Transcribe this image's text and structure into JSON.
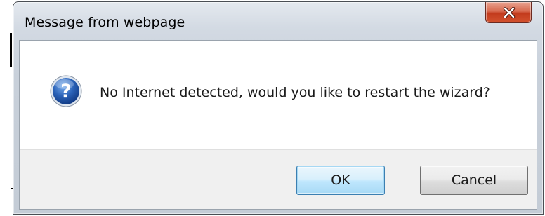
{
  "dialog": {
    "title": "Message from webpage",
    "message": "No Internet detected, would you like to restart the wizard?",
    "icon": "question-icon"
  },
  "buttons": {
    "ok_label": "OK",
    "cancel_label": "Cancel",
    "close_icon": "close-icon"
  },
  "colors": {
    "close_button": "#c23a1c",
    "ok_border": "#3c7fb1",
    "question_icon": "#2a62b8"
  }
}
